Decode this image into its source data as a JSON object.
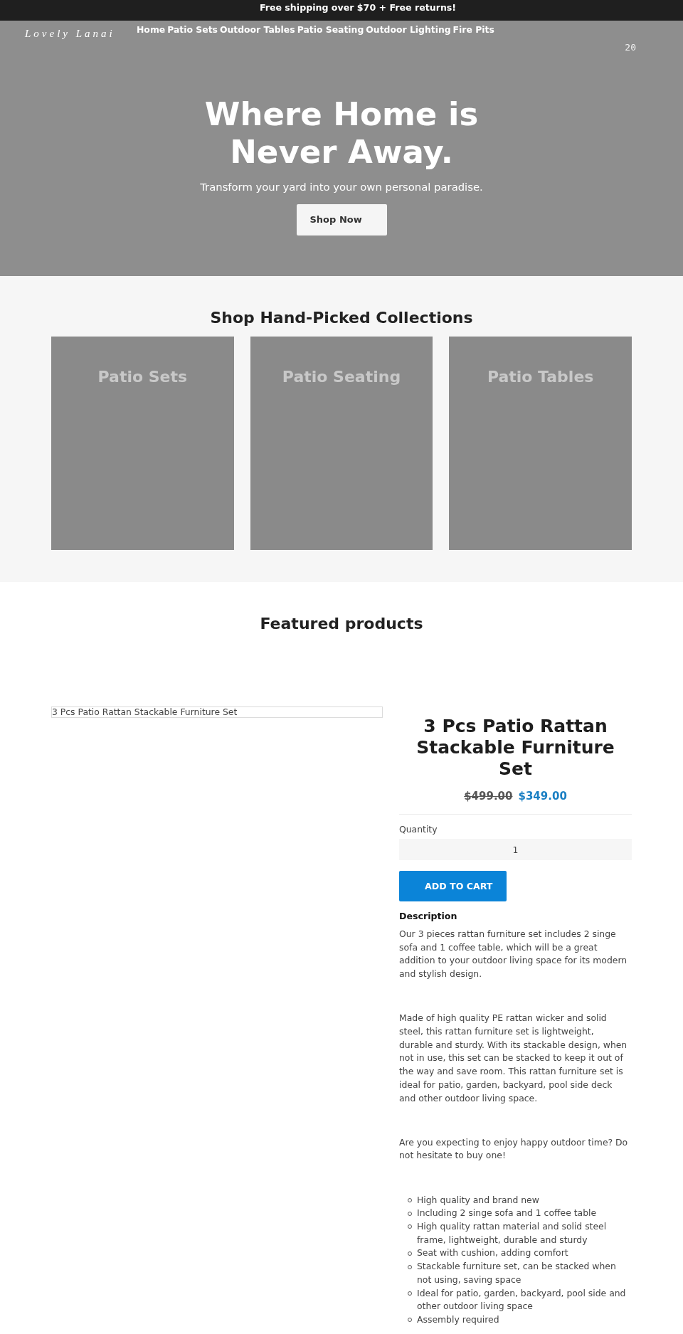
{
  "promo_bar": {
    "text": "Free shipping over $70 + Free returns!"
  },
  "header": {
    "logo": "Lovely Lanai",
    "nav": [
      {
        "label": "Home"
      },
      {
        "label": "Patio Sets"
      },
      {
        "label": "Outdoor Tables"
      },
      {
        "label": "Patio Seating"
      },
      {
        "label": "Outdoor Lighting"
      },
      {
        "label": "Fire Pits"
      }
    ],
    "counter": "20"
  },
  "hero": {
    "title": "Where Home is Never Away.",
    "subtitle": "Transform your yard into your own personal paradise.",
    "button": "Shop Now"
  },
  "collections": {
    "title": "Shop Hand-Picked Collections",
    "items": [
      {
        "title": "Patio Sets"
      },
      {
        "title": "Patio Seating"
      },
      {
        "title": "Patio Tables"
      }
    ]
  },
  "featured": {
    "title": "Featured products",
    "product": {
      "image_alt": "3 Pcs Patio Rattan Stackable Furniture Set",
      "title": "3 Pcs Patio Rattan Stackable Furniture Set",
      "compare_price": "$499.00",
      "price": "$349.00",
      "quantity_label": "Quantity",
      "quantity": "1",
      "button": "ADD TO CART",
      "description_heading": "Description",
      "paragraphs": [
        "Our 3 pieces rattan furniture set includes 2 singe sofa and 1 coffee table, which will be a great addition to your outdoor living space for its modern and stylish design.",
        "Made of high quality PE rattan wicker and solid steel, this rattan furniture set is lightweight, durable and sturdy. With its stackable design, when not in use, this set can be stacked to keep it out of the way and save room. This rattan furniture set is ideal for patio, garden, backyard, pool side deck and other outdoor living space.",
        "Are you expecting to enjoy happy outdoor time? Do not hesitate to buy one!"
      ],
      "features": [
        "High quality and brand new",
        "Including 2 singe sofa and 1 coffee table",
        "High quality rattan material and solid steel frame, lightweight, durable and sturdy",
        "Seat with cushion, adding comfort",
        "Stackable furniture set, can be stacked when not using, saving space",
        "Ideal for patio, garden, backyard, pool side and other outdoor living space",
        "Assembly required"
      ]
    }
  }
}
